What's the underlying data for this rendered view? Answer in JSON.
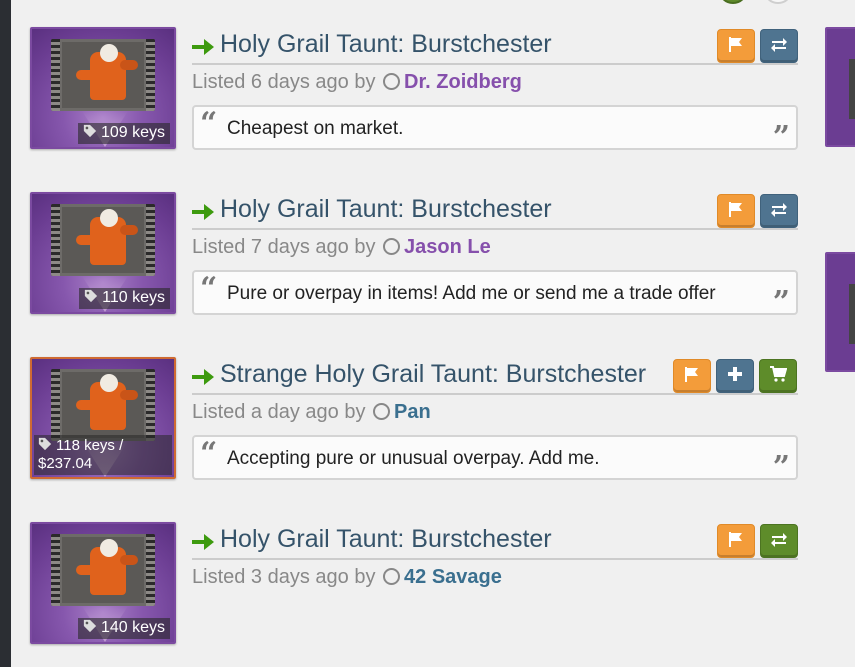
{
  "listings": [
    {
      "title": "Holy Grail Taunt: Burstchester",
      "price": "109 keys",
      "listed": "Listed 6 days ago by",
      "user": "Dr. Zoidberg",
      "quote": "Cheapest on market."
    },
    {
      "title": "Holy Grail Taunt: Burstchester",
      "price": "110 keys",
      "listed": "Listed 7 days ago by",
      "user": "Jason Le",
      "quote": "Pure or overpay in items! Add me or send me a trade offer"
    },
    {
      "title": "Strange Holy Grail Taunt: Burstchester",
      "price": "118 keys / $237.04",
      "listed": "Listed a day ago by",
      "user": "Pan",
      "quote": "Accepting pure or unusual overpay. Add me."
    },
    {
      "title": "Holy Grail Taunt: Burstchester",
      "price": "140 keys",
      "listed": "Listed 3 days ago by",
      "user": "42 Savage"
    }
  ],
  "icons": {
    "arrow": "arrow-right-icon",
    "flag": "flag-icon",
    "trade": "trade-arrows-icon",
    "add": "plus-icon",
    "cart": "cart-icon",
    "tag": "tag-icon",
    "quote_open": "quote-open-icon",
    "quote_close": "quote-close-icon"
  },
  "colors": {
    "title": "#35536a",
    "arrow": "#3d9a0e",
    "flag_button": "#f39c3a",
    "blue_button": "#4f7490",
    "green_button": "#5e8c2a",
    "user_purple": "#8650ac",
    "user_blue": "#3a6f8f",
    "unique_border": "#7b4aa0",
    "strange_border": "#cf6a32"
  }
}
